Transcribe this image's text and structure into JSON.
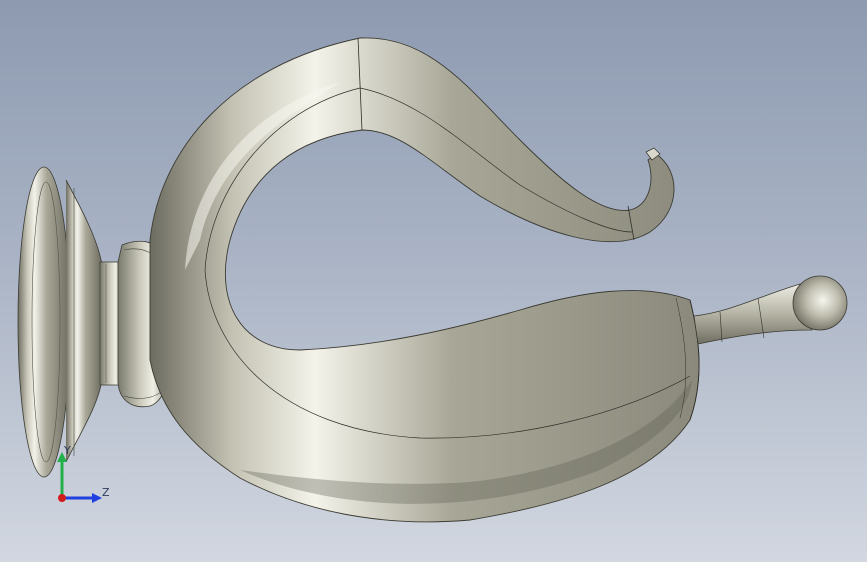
{
  "viewport": {
    "background_top": "#8d9ab0",
    "background_bottom": "#d2d7e0",
    "model_color": "#b7b6a6"
  },
  "triad": {
    "x_color": "#d01c1c",
    "y_color": "#22b04a",
    "z_color": "#1f3fe0",
    "y_label": "Y",
    "z_label": "Z"
  }
}
